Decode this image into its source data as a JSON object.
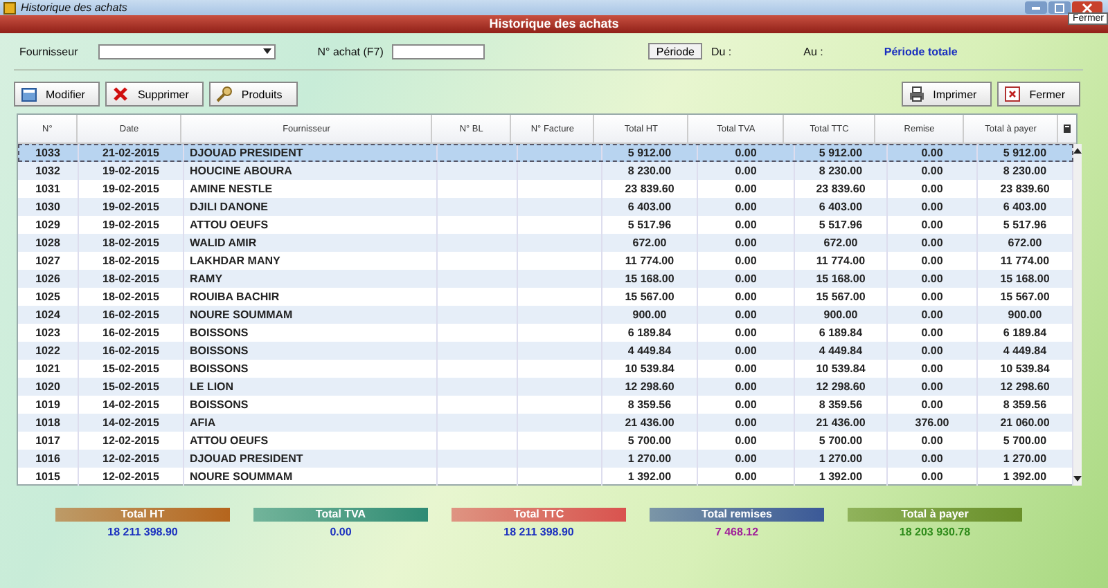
{
  "window": {
    "title": "Historique des achats",
    "tooltip": "Fermer"
  },
  "header": {
    "title": "Historique des achats"
  },
  "filters": {
    "supplier_label": "Fournisseur",
    "number_label": "N° achat (F7)",
    "period_button": "Période",
    "from_label": "Du :",
    "to_label": "Au :",
    "period_value": "Période totale"
  },
  "left_buttons": [
    {
      "label": "Modifier",
      "kind": "edit"
    },
    {
      "label": "Supprimer",
      "kind": "delete"
    },
    {
      "label": "Produits",
      "kind": "products"
    }
  ],
  "right_buttons": [
    {
      "label": "Imprimer",
      "kind": "print"
    },
    {
      "label": "Fermer",
      "kind": "close"
    }
  ],
  "table": {
    "columns": [
      "N°",
      "Date",
      "Fournisseur",
      "N° BL",
      "N° Facture",
      "Total HT",
      "Total TVA",
      "Total TTC",
      "Remise",
      "Total à payer"
    ],
    "rows": [
      {
        "selected": true,
        "cells": [
          "1033",
          "21-02-2015",
          "DJOUAD PRESIDENT",
          "",
          "",
          "5 912.00",
          "0.00",
          "5 912.00",
          "0.00",
          "5 912.00"
        ]
      },
      {
        "selected": false,
        "cells": [
          "1032",
          "19-02-2015",
          "HOUCINE ABOURA",
          "",
          "",
          "8 230.00",
          "0.00",
          "8 230.00",
          "0.00",
          "8 230.00"
        ]
      },
      {
        "selected": false,
        "cells": [
          "1031",
          "19-02-2015",
          "AMINE NESTLE",
          "",
          "",
          "23 839.60",
          "0.00",
          "23 839.60",
          "0.00",
          "23 839.60"
        ]
      },
      {
        "selected": false,
        "cells": [
          "1030",
          "19-02-2015",
          "DJILI DANONE",
          "",
          "",
          "6 403.00",
          "0.00",
          "6 403.00",
          "0.00",
          "6 403.00"
        ]
      },
      {
        "selected": false,
        "cells": [
          "1029",
          "19-02-2015",
          "ATTOU OEUFS",
          "",
          "",
          "5 517.96",
          "0.00",
          "5 517.96",
          "0.00",
          "5 517.96"
        ]
      },
      {
        "selected": false,
        "cells": [
          "1028",
          "18-02-2015",
          "WALID AMIR",
          "",
          "",
          "672.00",
          "0.00",
          "672.00",
          "0.00",
          "672.00"
        ]
      },
      {
        "selected": false,
        "cells": [
          "1027",
          "18-02-2015",
          "LAKHDAR MANY",
          "",
          "",
          "11 774.00",
          "0.00",
          "11 774.00",
          "0.00",
          "11 774.00"
        ]
      },
      {
        "selected": false,
        "cells": [
          "1026",
          "18-02-2015",
          "RAMY",
          "",
          "",
          "15 168.00",
          "0.00",
          "15 168.00",
          "0.00",
          "15 168.00"
        ]
      },
      {
        "selected": false,
        "cells": [
          "1025",
          "18-02-2015",
          "ROUIBA BACHIR",
          "",
          "",
          "15 567.00",
          "0.00",
          "15 567.00",
          "0.00",
          "15 567.00"
        ]
      },
      {
        "selected": false,
        "cells": [
          "1024",
          "16-02-2015",
          "NOURE SOUMMAM",
          "",
          "",
          "900.00",
          "0.00",
          "900.00",
          "0.00",
          "900.00"
        ]
      },
      {
        "selected": false,
        "cells": [
          "1023",
          "16-02-2015",
          "BOISSONS",
          "",
          "",
          "6 189.84",
          "0.00",
          "6 189.84",
          "0.00",
          "6 189.84"
        ]
      },
      {
        "selected": false,
        "cells": [
          "1022",
          "16-02-2015",
          "BOISSONS",
          "",
          "",
          "4 449.84",
          "0.00",
          "4 449.84",
          "0.00",
          "4 449.84"
        ]
      },
      {
        "selected": false,
        "cells": [
          "1021",
          "15-02-2015",
          "BOISSONS",
          "",
          "",
          "10 539.84",
          "0.00",
          "10 539.84",
          "0.00",
          "10 539.84"
        ]
      },
      {
        "selected": false,
        "cells": [
          "1020",
          "15-02-2015",
          "LE LION",
          "",
          "",
          "12 298.60",
          "0.00",
          "12 298.60",
          "0.00",
          "12 298.60"
        ]
      },
      {
        "selected": false,
        "cells": [
          "1019",
          "14-02-2015",
          "BOISSONS",
          "",
          "",
          "8 359.56",
          "0.00",
          "8 359.56",
          "0.00",
          "8 359.56"
        ]
      },
      {
        "selected": false,
        "cells": [
          "1018",
          "14-02-2015",
          "AFIA",
          "",
          "",
          "21 436.00",
          "0.00",
          "21 436.00",
          "376.00",
          "21 060.00"
        ]
      },
      {
        "selected": false,
        "cells": [
          "1017",
          "12-02-2015",
          "ATTOU OEUFS",
          "",
          "",
          "5 700.00",
          "0.00",
          "5 700.00",
          "0.00",
          "5 700.00"
        ]
      },
      {
        "selected": false,
        "cells": [
          "1016",
          "12-02-2015",
          "DJOUAD PRESIDENT",
          "",
          "",
          "1 270.00",
          "0.00",
          "1 270.00",
          "0.00",
          "1 270.00"
        ]
      },
      {
        "selected": false,
        "cells": [
          "1015",
          "12-02-2015",
          "NOURE SOUMMAM",
          "",
          "",
          "1 392.00",
          "0.00",
          "1 392.00",
          "0.00",
          "1 392.00"
        ]
      }
    ]
  },
  "totals": [
    {
      "label": "Total HT",
      "value": "18 211 398.90",
      "color": "#b5651d",
      "kind": "amount"
    },
    {
      "label": "Total TVA",
      "value": "0.00",
      "color": "#2e8b74",
      "kind": "amount"
    },
    {
      "label": "Total TTC",
      "value": "18 211 398.90",
      "color": "#d9534f",
      "kind": "amount"
    },
    {
      "label": "Total remises",
      "value": "7 468.12",
      "color": "#3b5998",
      "kind": "discount"
    },
    {
      "label": "Total à payer",
      "value": "18 203 930.78",
      "color": "#6a8f2a",
      "kind": "net"
    }
  ]
}
